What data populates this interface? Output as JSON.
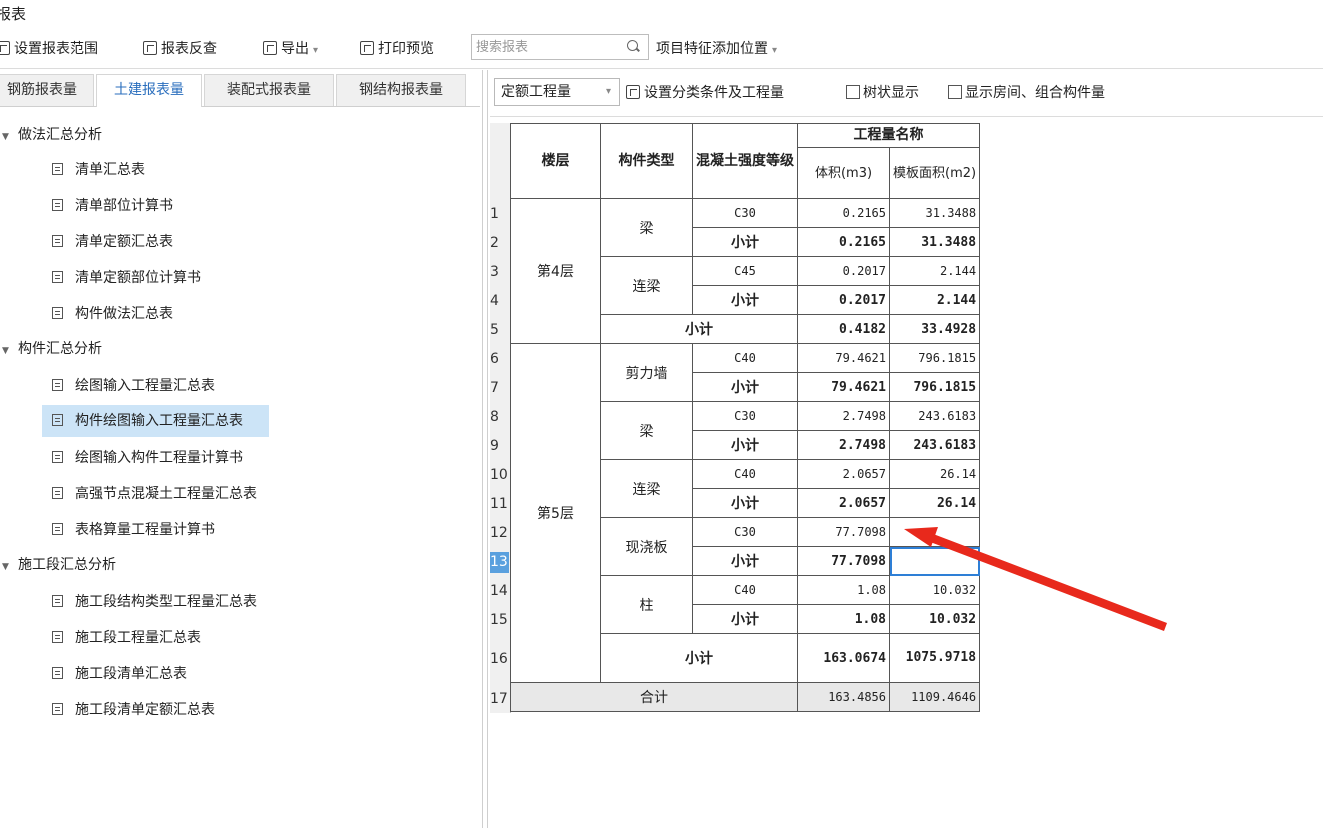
{
  "window": {
    "title": "报表"
  },
  "toolbar": {
    "set_range": "设置报表范围",
    "reverse_check": "报表反查",
    "export": "导出",
    "print_preview": "打印预览",
    "search_placeholder": "搜索报表",
    "feature_position": "项目特征添加位置"
  },
  "tabs": [
    "钢筋报表量",
    "土建报表量",
    "装配式报表量",
    "钢结构报表量"
  ],
  "active_tab": "土建报表量",
  "tree": {
    "groups": [
      {
        "label": "做法汇总分析",
        "items": [
          "清单汇总表",
          "清单部位计算书",
          "清单定额汇总表",
          "清单定额部位计算书",
          "构件做法汇总表"
        ]
      },
      {
        "label": "构件汇总分析",
        "items": [
          "绘图输入工程量汇总表",
          "构件绘图输入工程量汇总表",
          "绘图输入构件工程量计算书",
          "高强节点混凝土工程量汇总表",
          "表格算量工程量计算书"
        ]
      },
      {
        "label": "施工段汇总分析",
        "items": [
          "施工段结构类型工程量汇总表",
          "施工段工程量汇总表",
          "施工段清单汇总表",
          "施工段清单定额汇总表"
        ]
      }
    ],
    "selected_item": "构件绘图输入工程量汇总表"
  },
  "right_toolbar": {
    "select_value": "定额工程量",
    "set_conditions": "设置分类条件及工程量",
    "tree_display": "树状显示",
    "show_rooms": "显示房间、组合构件量"
  },
  "table": {
    "headers": {
      "floor": "楼层",
      "component_type": "构件类型",
      "concrete_grade": "混凝土强度等级",
      "quantity_name": "工程量名称",
      "volume": "体积(m3)",
      "formwork": "模板面积(m2)"
    },
    "row_numbers": [
      "1",
      "2",
      "3",
      "4",
      "5",
      "6",
      "7",
      "8",
      "9",
      "10",
      "11",
      "12",
      "13",
      "14",
      "15",
      "16",
      "17"
    ],
    "selected_row": "13",
    "subtotal_label": "小计",
    "total_label": "合计",
    "floors": [
      {
        "name": "第4层",
        "components": [
          {
            "type": "梁",
            "grade": "C30",
            "volume": "0.2165",
            "formwork": "31.3488",
            "sub_volume": "0.2165",
            "sub_formwork": "31.3488"
          },
          {
            "type": "连梁",
            "grade": "C45",
            "volume": "0.2017",
            "formwork": "2.144",
            "sub_volume": "0.2017",
            "sub_formwork": "2.144"
          }
        ],
        "subtotal_volume": "0.4182",
        "subtotal_formwork": "33.4928"
      },
      {
        "name": "第5层",
        "components": [
          {
            "type": "剪力墙",
            "grade": "C40",
            "volume": "79.4621",
            "formwork": "796.1815",
            "sub_volume": "79.4621",
            "sub_formwork": "796.1815"
          },
          {
            "type": "梁",
            "grade": "C30",
            "volume": "2.7498",
            "formwork": "243.6183",
            "sub_volume": "2.7498",
            "sub_formwork": "243.6183"
          },
          {
            "type": "连梁",
            "grade": "C40",
            "volume": "2.0657",
            "formwork": "26.14",
            "sub_volume": "2.0657",
            "sub_formwork": "26.14"
          },
          {
            "type": "现浇板",
            "grade": "C30",
            "volume": "77.7098",
            "formwork": "",
            "sub_volume": "77.7098",
            "sub_formwork": ""
          },
          {
            "type": "柱",
            "grade": "C40",
            "volume": "1.08",
            "formwork": "10.032",
            "sub_volume": "1.08",
            "sub_formwork": "10.032"
          }
        ],
        "subtotal_volume": "163.0674",
        "subtotal_formwork": "1075.9718"
      }
    ],
    "total_volume": "163.4856",
    "total_formwork": "1109.4646"
  },
  "colors": {
    "annotation_arrow": "#e8291c",
    "selection": "#cce4f7",
    "active_tab_text": "#2a6ebd"
  }
}
